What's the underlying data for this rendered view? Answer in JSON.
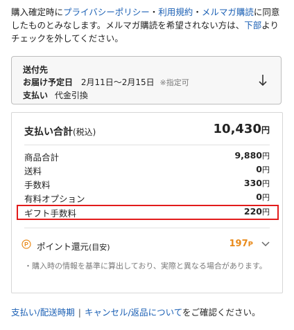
{
  "consent": {
    "text_before": "購入確定時に",
    "privacy_link": "プライバシーポリシー",
    "dot1": "・",
    "terms_link": "利用規約",
    "dot2": "・",
    "newsletter_link": "メルマガ購読",
    "text_middle": "に同意したものとみなします。メルマガ購読を希望されない方は、",
    "below_link": "下部",
    "text_after": "よりチェックを外してください。"
  },
  "shipping": {
    "heading": "送付先",
    "delivery_label": "お届け予定日",
    "delivery_dates": "2月11日～2月15日",
    "delivery_note": "※指定可",
    "payment_label": "支払い",
    "payment_method": "代金引換",
    "icon": "arrow-down-icon"
  },
  "summary": {
    "total_label": "支払い合計",
    "total_note": "(税込)",
    "total_value": "10,430",
    "yen": "円",
    "items": [
      {
        "label": "商品合計",
        "value": "9,880"
      },
      {
        "label": "送料",
        "value": "0"
      },
      {
        "label": "手数料",
        "value": "330"
      },
      {
        "label": "有料オプション",
        "value": "0"
      },
      {
        "label": "ギフト手数料",
        "value": "220"
      }
    ],
    "highlight_color": "#e21b1b"
  },
  "points": {
    "label": "ポイント還元",
    "label_note": "(目安)",
    "value": "197",
    "unit": "P",
    "color": "#e98a1a",
    "note": "・購入時の情報を基準に算出しており、実際と異なる場合があります。"
  },
  "footer": {
    "link1": "支払い/配送時期",
    "separator": "|",
    "link2": "キャンセル/返品について",
    "text": "をご確認ください。"
  },
  "colors": {
    "link": "#1a5fb4",
    "accent": "#e98a1a",
    "highlight": "#e21b1b"
  }
}
